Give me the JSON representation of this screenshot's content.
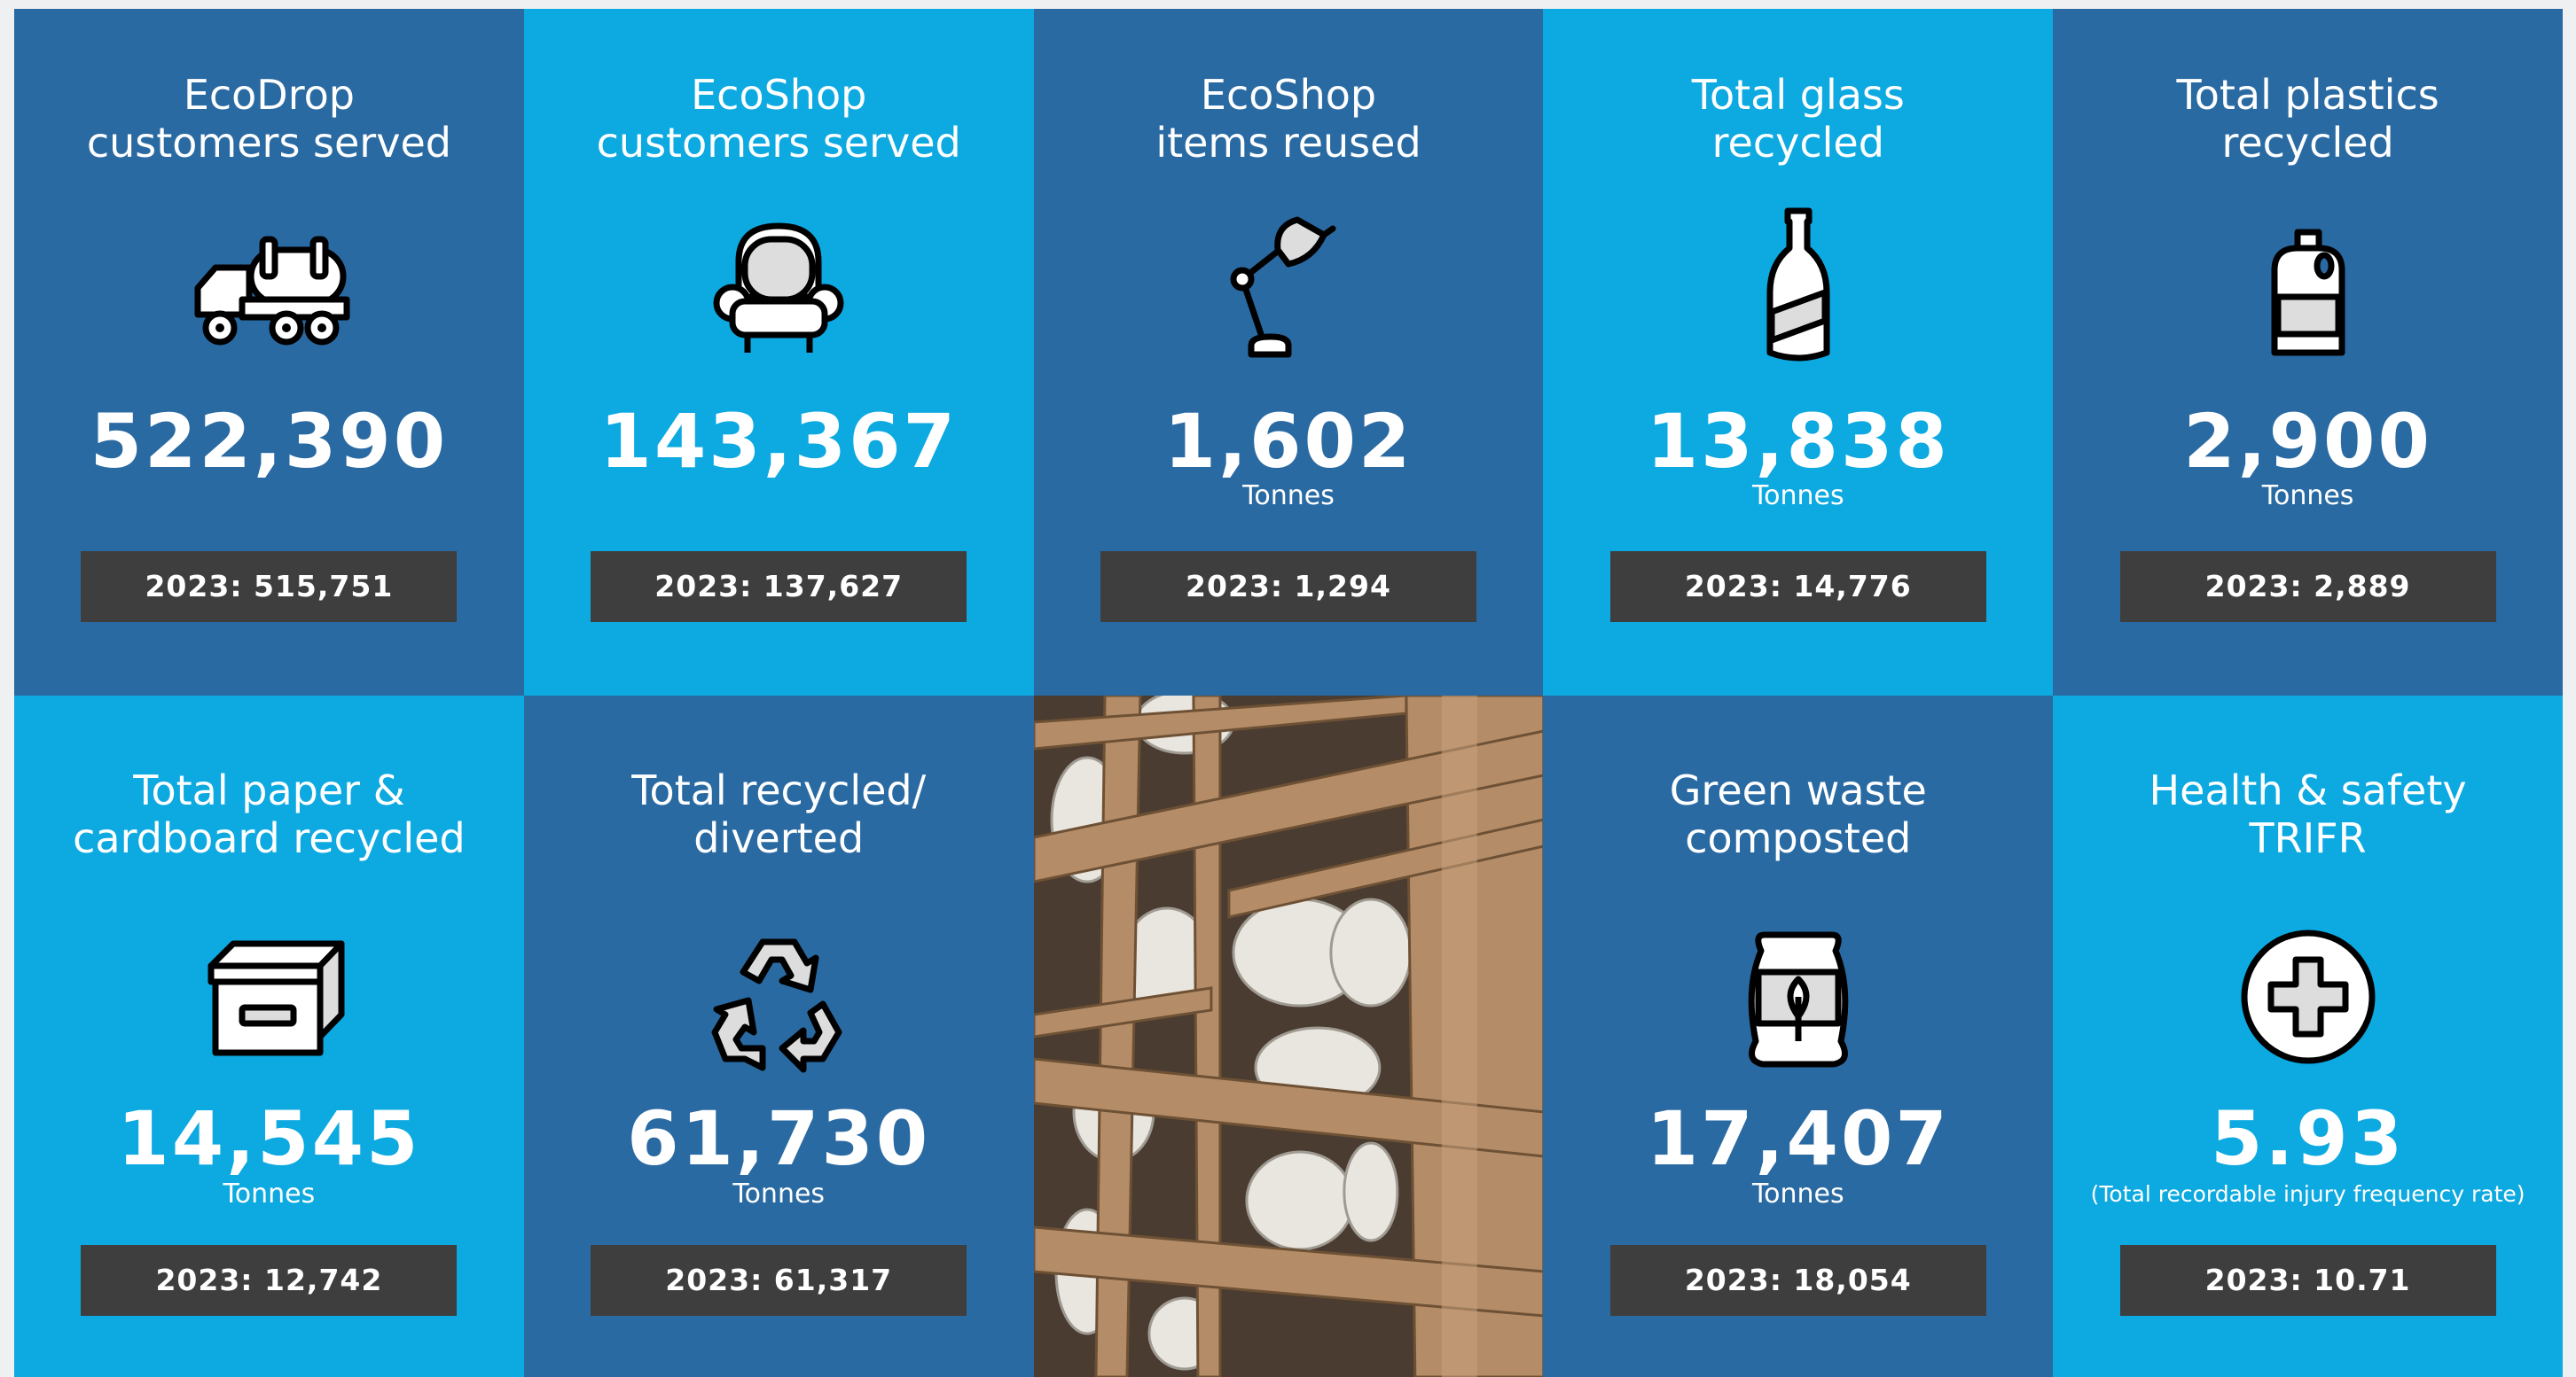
{
  "tiles": [
    {
      "title": "EcoDrop\ncustomers served",
      "icon": "tanker-truck-icon",
      "value": "522,390",
      "unit": "",
      "previous": "2023: 515,751"
    },
    {
      "title": "EcoShop\ncustomers served",
      "icon": "armchair-icon",
      "value": "143,367",
      "unit": "",
      "previous": "2023: 137,627"
    },
    {
      "title": "EcoShop\nitems reused",
      "icon": "desk-lamp-icon",
      "value": "1,602",
      "unit": "Tonnes",
      "previous": "2023: 1,294"
    },
    {
      "title": "Total glass\nrecycled",
      "icon": "glass-bottle-icon",
      "value": "13,838",
      "unit": "Tonnes",
      "previous": "2023: 14,776"
    },
    {
      "title": "Total plastics\nrecycled",
      "icon": "plastic-jug-icon",
      "value": "2,900",
      "unit": "Tonnes",
      "previous": "2023: 2,889"
    },
    {
      "title": "Total paper &\ncardboard recycled",
      "icon": "cardboard-box-icon",
      "value": "14,545",
      "unit": "Tonnes",
      "previous": "2023: 12,742"
    },
    {
      "title": "Total recycled/\ndiverted",
      "icon": "recycle-icon",
      "value": "61,730",
      "unit": "Tonnes",
      "previous": "2023: 61,317"
    },
    {
      "title": "Green waste\ncomposted",
      "icon": "compost-bag-icon",
      "value": "17,407",
      "unit": "Tonnes",
      "previous": "2023: 18,054"
    },
    {
      "title": "Health & safety\nTRIFR",
      "icon": "first-aid-cross-icon",
      "value": "5.93",
      "unit": "(Total recordable injury frequency rate)",
      "previous": "2023: 10.71"
    }
  ],
  "colors": {
    "dark_blue": "#2a6aa2",
    "light_blue": "#0da9e1",
    "badge": "#3e3e3e",
    "text": "#ffffff"
  },
  "photo": {
    "subject": "gas-bottles-in-wooden-crates-photo"
  }
}
